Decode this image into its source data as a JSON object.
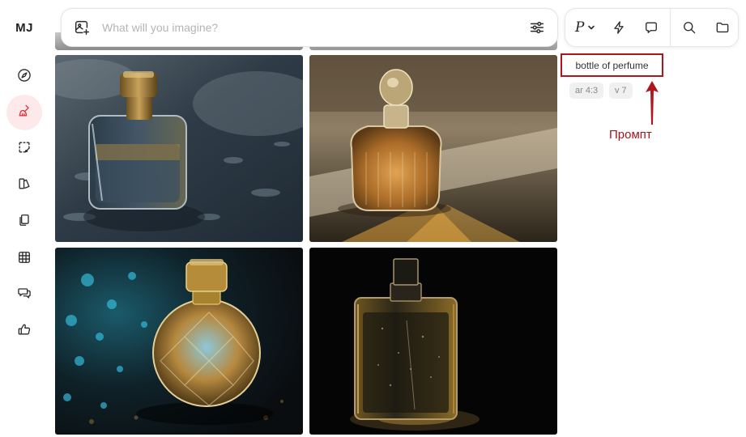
{
  "sidebar": {
    "logo": "MJ",
    "items": [
      {
        "icon": "compass-icon"
      },
      {
        "icon": "brush-icon",
        "active": true
      },
      {
        "icon": "edit-dashed-icon"
      },
      {
        "icon": "styles-icon"
      },
      {
        "icon": "copy-icon"
      },
      {
        "icon": "grid-icon"
      },
      {
        "icon": "chat-bubbles-icon"
      },
      {
        "icon": "thumbs-up-icon"
      }
    ]
  },
  "search": {
    "placeholder": "What will you imagine?",
    "value": ""
  },
  "toolbar": {
    "personalize_label": "P"
  },
  "prompt": {
    "text": "bottle of perfume",
    "params": [
      "ar 4:3",
      "v 7"
    ]
  },
  "annotation": {
    "label": "Промпт"
  },
  "colors": {
    "accent_active": "#e2333d",
    "active_bg": "#fde9ea",
    "annotation": "#a8141c"
  }
}
